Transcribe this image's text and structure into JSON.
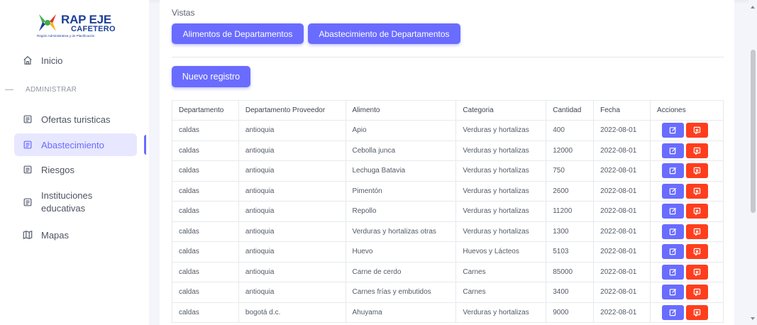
{
  "brand": {
    "title_main": "RAP EJE",
    "title_sub": "CAFETERO",
    "tagline": "Región Administrativa y de Planificación"
  },
  "sidebar": {
    "inicio": "Inicio",
    "section": "ADMINISTRAR",
    "ofertas": "Ofertas turisticas",
    "abastecimiento": "Abastecimiento",
    "riesgos": "Riesgos",
    "instituciones_line1": "Instituciones",
    "instituciones_line2": "educativas",
    "mapas": "Mapas"
  },
  "main": {
    "vistas_label": "Vistas",
    "btn_alimentos": "Alimentos de Departamentos",
    "btn_abastecimiento": "Abastecimiento de Departamentos",
    "btn_nuevo": "Nuevo registro"
  },
  "colors": {
    "primary": "#696cff",
    "danger": "#ff3e1d",
    "active_bg": "#e7e7ff"
  },
  "table": {
    "headers": [
      "Departamento",
      "Departamento Proveedor",
      "Alimento",
      "Categoria",
      "Cantidad",
      "Fecha",
      "Acciones"
    ],
    "rows": [
      [
        "caldas",
        "antioquia",
        "Apio",
        "Verduras y hortalizas",
        "400",
        "2022-08-01"
      ],
      [
        "caldas",
        "antioquia",
        "Cebolla junca",
        "Verduras y hortalizas",
        "12000",
        "2022-08-01"
      ],
      [
        "caldas",
        "antioquia",
        "Lechuga Batavia",
        "Verduras y hortalizas",
        "750",
        "2022-08-01"
      ],
      [
        "caldas",
        "antioquia",
        "Pimentón",
        "Verduras y hortalizas",
        "2600",
        "2022-08-01"
      ],
      [
        "caldas",
        "antioquia",
        "Repollo",
        "Verduras y hortalizas",
        "11200",
        "2022-08-01"
      ],
      [
        "caldas",
        "antioquia",
        "Verduras y hortalizas otras",
        "Verduras y hortalizas",
        "1300",
        "2022-08-01"
      ],
      [
        "caldas",
        "antioquia",
        "Huevo",
        "Huevos y Lácteos",
        "5103",
        "2022-08-01"
      ],
      [
        "caldas",
        "antioquia",
        "Carne de cerdo",
        "Carnes",
        "85000",
        "2022-08-01"
      ],
      [
        "caldas",
        "antioquia",
        "Carnes frías y embutidos",
        "Carnes",
        "3400",
        "2022-08-01"
      ],
      [
        "caldas",
        "bogotá d.c.",
        "Ahuyama",
        "Verduras y hortalizas",
        "9000",
        "2022-08-01"
      ]
    ]
  }
}
